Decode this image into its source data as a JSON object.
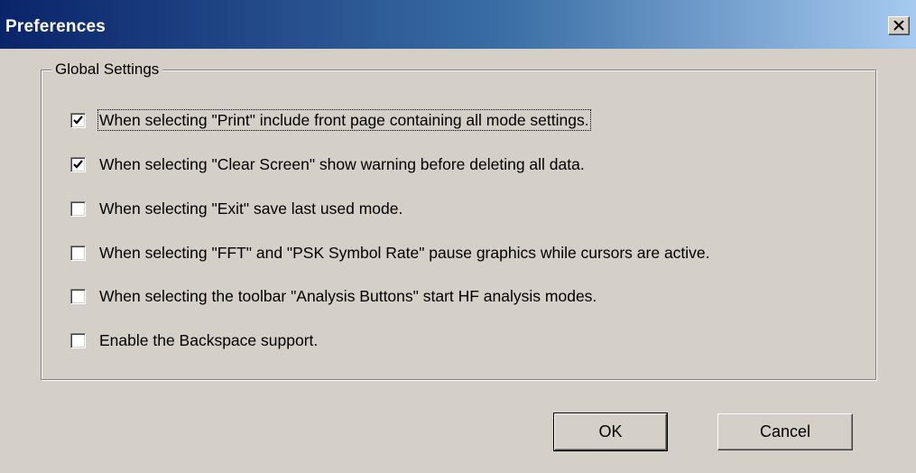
{
  "window": {
    "title": "Preferences",
    "close_icon": "close-icon"
  },
  "group": {
    "legend": "Global Settings",
    "options": [
      {
        "label": "When selecting \"Print\" include front page containing all mode settings.",
        "checked": true,
        "focused": true
      },
      {
        "label": "When selecting \"Clear Screen\" show warning before deleting all data.",
        "checked": true,
        "focused": false
      },
      {
        "label": "When selecting \"Exit\" save last used mode.",
        "checked": false,
        "focused": false
      },
      {
        "label": "When selecting \"FFT\" and \"PSK Symbol Rate\" pause graphics while cursors are active.",
        "checked": false,
        "focused": false
      },
      {
        "label": "When selecting the toolbar \"Analysis Buttons\" start HF analysis modes.",
        "checked": false,
        "focused": false
      },
      {
        "label": "Enable the Backspace support.",
        "checked": false,
        "focused": false
      }
    ]
  },
  "buttons": {
    "ok_label": "OK",
    "cancel_label": "Cancel"
  },
  "colors": {
    "titlebar_start": "#0a246a",
    "titlebar_end": "#a6caf0",
    "face": "#d4d0c8"
  }
}
